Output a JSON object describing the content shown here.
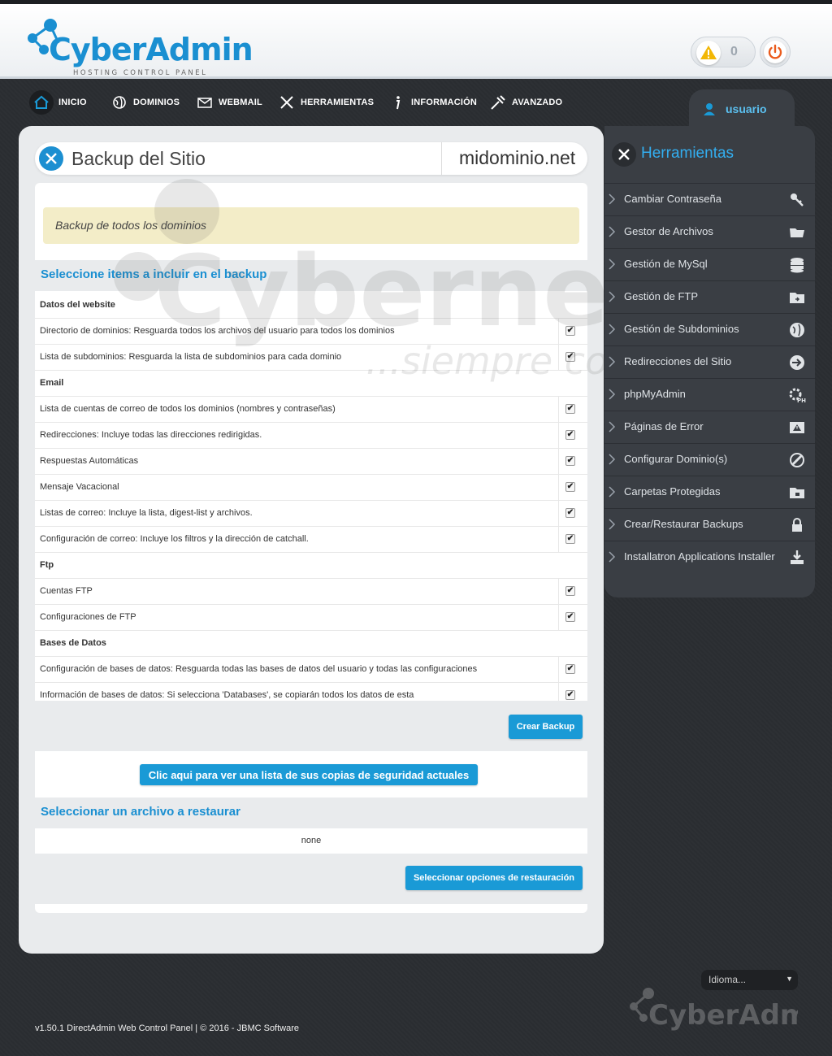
{
  "brand": {
    "name": "CyberAdmin",
    "tagline": "HOSTING CONTROL PANEL",
    "accent": "#1a8fd1"
  },
  "header": {
    "alert_count": "0"
  },
  "nav": {
    "items": [
      {
        "label": "INICIO",
        "icon": "home-icon"
      },
      {
        "label": "DOMINIOS",
        "icon": "globe-icon"
      },
      {
        "label": "WEBMAIL",
        "icon": "envelope-icon"
      },
      {
        "label": "HERRAMIENTAS",
        "icon": "tools-icon"
      },
      {
        "label": "INFORMACIÓN",
        "icon": "info-icon"
      },
      {
        "label": "AVANZADO",
        "icon": "wrench-icon"
      }
    ]
  },
  "user": {
    "name": "usuario"
  },
  "page": {
    "title": "Backup del Sitio",
    "domain": "midominio.net",
    "notice": "Backup de todos los dominios",
    "select_heading": "Seleccione items a incluir en el backup",
    "rows": [
      {
        "type": "cat",
        "label": "Datos del website"
      },
      {
        "type": "item",
        "label": "Directorio de dominios: Resguarda todos los archivos del usuario para todos los dominios",
        "checked": true
      },
      {
        "type": "item",
        "label": "Lista de subdominios: Resguarda la lista de subdominios para cada dominio",
        "checked": true
      },
      {
        "type": "cat",
        "label": "Email"
      },
      {
        "type": "item",
        "label": "Lista de cuentas de correo de todos los dominios (nombres y contraseñas)",
        "checked": true
      },
      {
        "type": "item",
        "label": "Redirecciones: Incluye todas las direcciones redirigidas.",
        "checked": true
      },
      {
        "type": "item",
        "label": "Respuestas Automáticas",
        "checked": true
      },
      {
        "type": "item",
        "label": "Mensaje Vacacional",
        "checked": true
      },
      {
        "type": "item",
        "label": "Listas de correo: Incluye la lista, digest-list y archivos.",
        "checked": true
      },
      {
        "type": "item",
        "label": "Configuración de correo: Incluye los filtros y la dirección de catchall.",
        "checked": true
      },
      {
        "type": "cat",
        "label": "Ftp"
      },
      {
        "type": "item",
        "label": "Cuentas FTP",
        "checked": true
      },
      {
        "type": "item",
        "label": "Configuraciones de FTP",
        "checked": true
      },
      {
        "type": "cat",
        "label": "Bases de Datos"
      },
      {
        "type": "item",
        "label": "Configuración de bases de datos: Resguarda todas las bases de datos del usuario y todas las configuraciones",
        "checked": true
      },
      {
        "type": "item",
        "label": "Información de bases de datos: Si selecciona 'Databases', se copiarán todos los datos de esta",
        "checked": true
      }
    ],
    "create_button": "Crear Backup",
    "list_button": "Clic aqui para ver una lista de sus copias de seguridad actuales",
    "restore_heading": "Seleccionar un archivo a restaurar",
    "restore_value": "none",
    "restore_button": "Seleccionar opciones de restauración"
  },
  "sidebar": {
    "title": "Herramientas",
    "items": [
      {
        "label": "Cambiar Contraseña",
        "icon": "key-icon"
      },
      {
        "label": "Gestor de Archivos",
        "icon": "folder-icon"
      },
      {
        "label": "Gestión de MySql",
        "icon": "database-icon"
      },
      {
        "label": "Gestión de FTP",
        "icon": "ftp-folder-icon"
      },
      {
        "label": "Gestión de Subdominios",
        "icon": "subdomain-globe-icon"
      },
      {
        "label": "Redirecciones del Sitio",
        "icon": "redirect-arrow-icon"
      },
      {
        "label": "phpMyAdmin",
        "icon": "php-gear-icon"
      },
      {
        "label": "Páginas de Error",
        "icon": "error-page-icon"
      },
      {
        "label": "Configurar Dominio(s)",
        "icon": "domain-config-icon"
      },
      {
        "label": "Carpetas Protegidas",
        "icon": "locked-folder-icon"
      },
      {
        "label": "Crear/Restaurar Backups",
        "icon": "lock-icon"
      },
      {
        "label": "Installatron Applications Installer",
        "icon": "installer-icon"
      }
    ]
  },
  "language": {
    "selected": "Idioma..."
  },
  "footer": {
    "text": "v1.50.1 DirectAdmin Web Control Panel | © 2016 - JBMC Software"
  },
  "watermark": {
    "brand": "Cybernetics",
    "slogan": "...siempre conectados"
  }
}
